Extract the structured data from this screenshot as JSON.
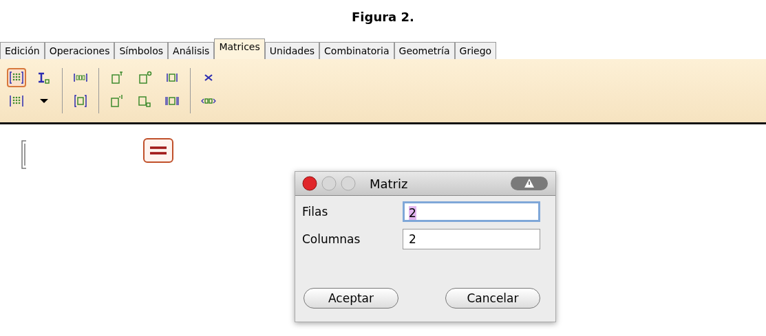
{
  "caption": "Figura 2.",
  "tabs": [
    {
      "label": "Edición",
      "selected": false
    },
    {
      "label": "Operaciones",
      "selected": false
    },
    {
      "label": "Símbolos",
      "selected": false
    },
    {
      "label": "Análisis",
      "selected": false
    },
    {
      "label": "Matrices",
      "selected": true
    },
    {
      "label": "Unidades",
      "selected": false
    },
    {
      "label": "Combinatoria",
      "selected": false
    },
    {
      "label": "Geometría",
      "selected": false
    },
    {
      "label": "Griego",
      "selected": false
    }
  ],
  "toolbar": {
    "groups": [
      [
        {
          "kind": "matrix",
          "selected": true
        },
        {
          "kind": "identity",
          "selected": false
        },
        {
          "kind": "determinant-matrix",
          "selected": false
        },
        {
          "kind": "dropdown",
          "selected": false
        }
      ],
      [
        {
          "kind": "row-vector",
          "selected": false
        },
        {
          "kind": "column-vector",
          "selected": false
        }
      ],
      [
        {
          "kind": "transpose",
          "selected": false
        },
        {
          "kind": "conjugate",
          "selected": false
        },
        {
          "kind": "abs",
          "selected": false
        },
        {
          "kind": "inverse",
          "selected": false
        },
        {
          "kind": "subscript",
          "selected": false
        },
        {
          "kind": "norm",
          "selected": false
        }
      ],
      [
        {
          "kind": "cross",
          "selected": false
        },
        {
          "kind": "inner",
          "selected": false
        }
      ]
    ]
  },
  "dialog": {
    "title": "Matriz",
    "fields": [
      {
        "label": "Filas",
        "value": "2",
        "focused": true
      },
      {
        "label": "Columnas",
        "value": "2",
        "focused": false
      }
    ],
    "buttons": [
      "Aceptar",
      "Cancelar"
    ]
  }
}
